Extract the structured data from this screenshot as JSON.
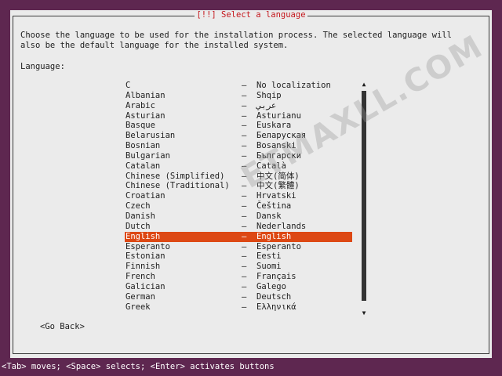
{
  "dialog": {
    "title": "[!!] Select a language",
    "description_line1": "Choose the language to be used for the installation process. The selected language will",
    "description_line2": "also be the default language for the installed system.",
    "list_label": "Language:",
    "separator": "–",
    "languages": [
      {
        "name": "C",
        "native": "No localization"
      },
      {
        "name": "Albanian",
        "native": "Shqip"
      },
      {
        "name": "Arabic",
        "native": "عربي"
      },
      {
        "name": "Asturian",
        "native": "Asturianu"
      },
      {
        "name": "Basque",
        "native": "Euskara"
      },
      {
        "name": "Belarusian",
        "native": "Беларуская"
      },
      {
        "name": "Bosnian",
        "native": "Bosanski"
      },
      {
        "name": "Bulgarian",
        "native": "Български"
      },
      {
        "name": "Catalan",
        "native": "Català"
      },
      {
        "name": "Chinese (Simplified)",
        "native": "中文(简体)"
      },
      {
        "name": "Chinese (Traditional)",
        "native": "中文(繁體)"
      },
      {
        "name": "Croatian",
        "native": "Hrvatski"
      },
      {
        "name": "Czech",
        "native": "Čeština"
      },
      {
        "name": "Danish",
        "native": "Dansk"
      },
      {
        "name": "Dutch",
        "native": "Nederlands"
      },
      {
        "name": "English",
        "native": "English",
        "selected": true
      },
      {
        "name": "Esperanto",
        "native": "Esperanto"
      },
      {
        "name": "Estonian",
        "native": "Eesti"
      },
      {
        "name": "Finnish",
        "native": "Suomi"
      },
      {
        "name": "French",
        "native": "Français"
      },
      {
        "name": "Galician",
        "native": "Galego"
      },
      {
        "name": "German",
        "native": "Deutsch"
      },
      {
        "name": "Greek",
        "native": "Ελληνικά"
      }
    ],
    "go_back_label": "<Go Back>",
    "scroll_up_glyph": "▲",
    "scroll_down_glyph": "▼"
  },
  "status_bar": {
    "text": "<Tab> moves; <Space> selects; <Enter> activates buttons"
  },
  "watermark": "ETMAXLL.COM",
  "colors": {
    "background": "#5e2750",
    "dialog": "#ebebeb",
    "title": "#c4161c",
    "selection": "#dd4814"
  }
}
